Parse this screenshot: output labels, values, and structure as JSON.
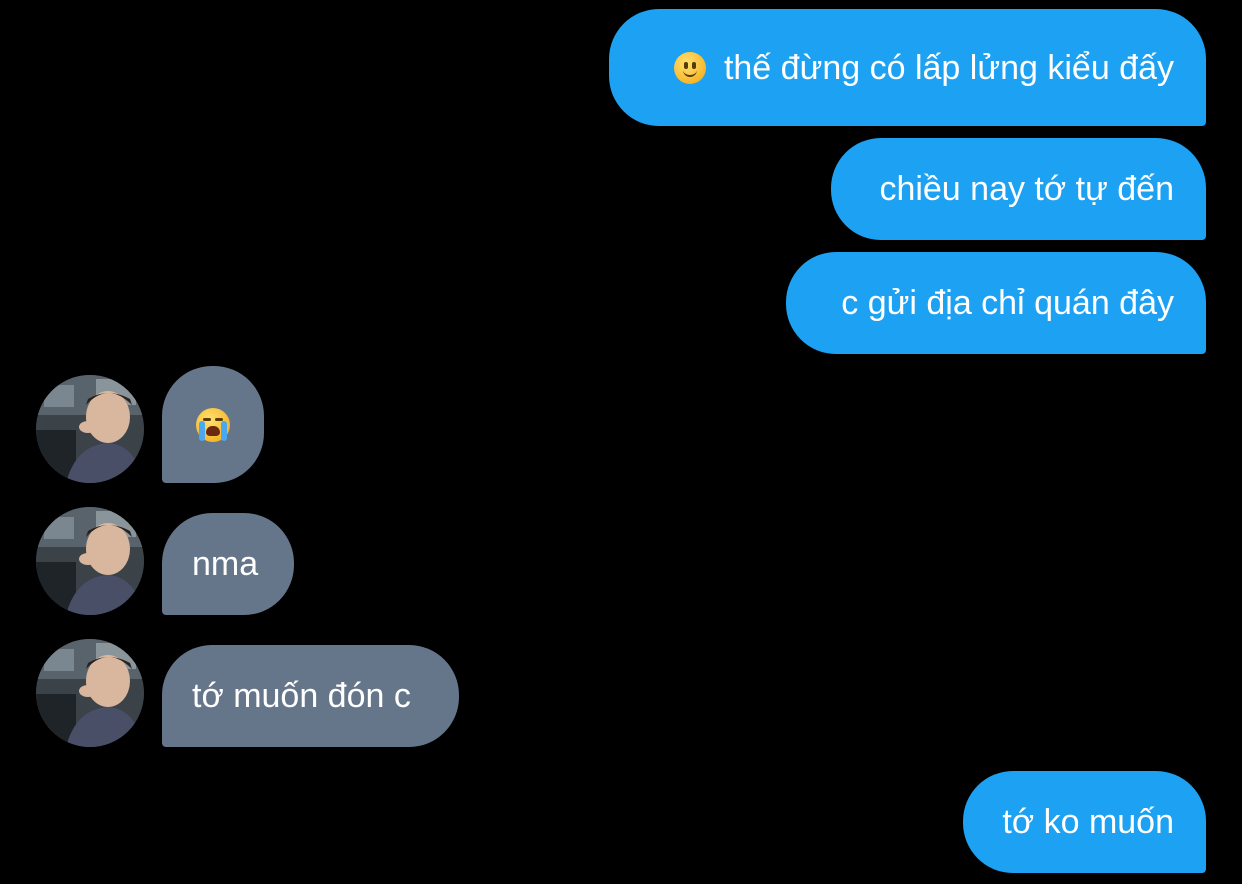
{
  "messages": [
    {
      "side": "sent",
      "text": "thế đừng có lấp lửng kiểu đấy",
      "emoji": "slightly-smiling-face"
    },
    {
      "side": "sent",
      "text": "chiều nay tớ tự đến"
    },
    {
      "side": "sent",
      "text": "c gửi địa chỉ quán đây"
    },
    {
      "side": "received",
      "emoji": "loudly-crying-face"
    },
    {
      "side": "received",
      "text": "nma"
    },
    {
      "side": "received",
      "text": "tớ muốn đón c"
    },
    {
      "side": "sent",
      "text": "tớ ko muốn"
    }
  ],
  "colors": {
    "background": "#000000",
    "sent_bubble": "#1da1f2",
    "received_bubble": "#66768a",
    "text": "#ffffff"
  }
}
